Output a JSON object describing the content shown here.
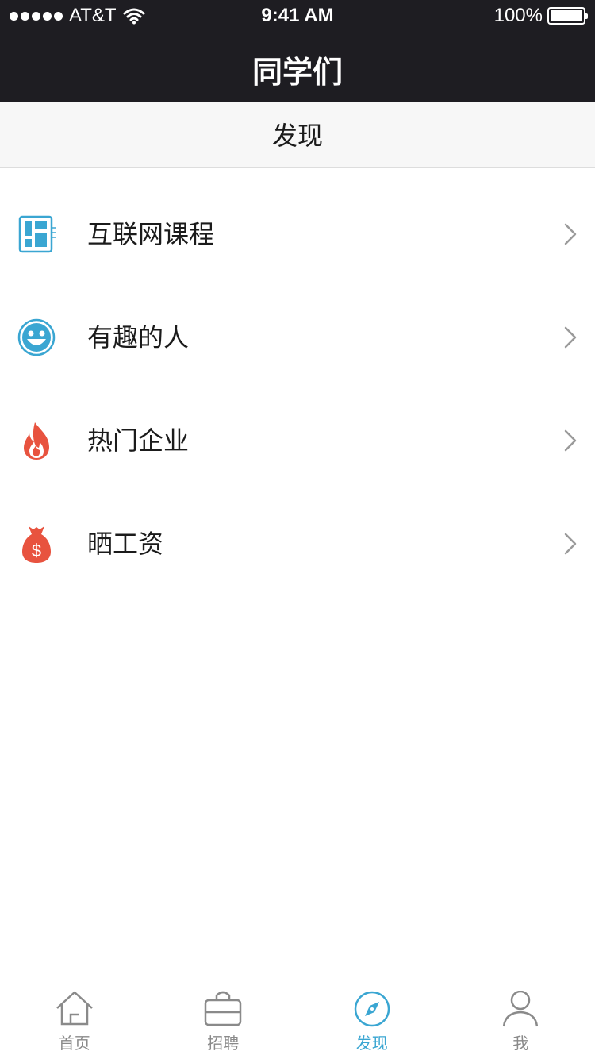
{
  "status_bar": {
    "carrier": "AT&T",
    "time": "9:41 AM",
    "battery": "100%",
    "battery_level": 1.0
  },
  "nav": {
    "title": "同学们"
  },
  "section": {
    "title": "发现"
  },
  "list": {
    "items": [
      {
        "label": "互联网课程",
        "icon": "course-icon",
        "icon_color": "#3aa6d2"
      },
      {
        "label": "有趣的人",
        "icon": "smiley-icon",
        "icon_color": "#3aa6d2"
      },
      {
        "label": "热门企业",
        "icon": "flame-icon",
        "icon_color": "#e8533f"
      },
      {
        "label": "晒工资",
        "icon": "money-bag-icon",
        "icon_color": "#e8533f"
      }
    ]
  },
  "tabbar": {
    "tabs": [
      {
        "label": "首页",
        "icon": "home-icon",
        "active": false
      },
      {
        "label": "招聘",
        "icon": "briefcase-icon",
        "active": false
      },
      {
        "label": "发现",
        "icon": "compass-icon",
        "active": true
      },
      {
        "label": "我",
        "icon": "person-icon",
        "active": false
      }
    ]
  },
  "colors": {
    "header_bg": "#1e1d22",
    "accent": "#3aa6d2",
    "warm": "#e8533f",
    "inactive": "#8a8a8a"
  }
}
